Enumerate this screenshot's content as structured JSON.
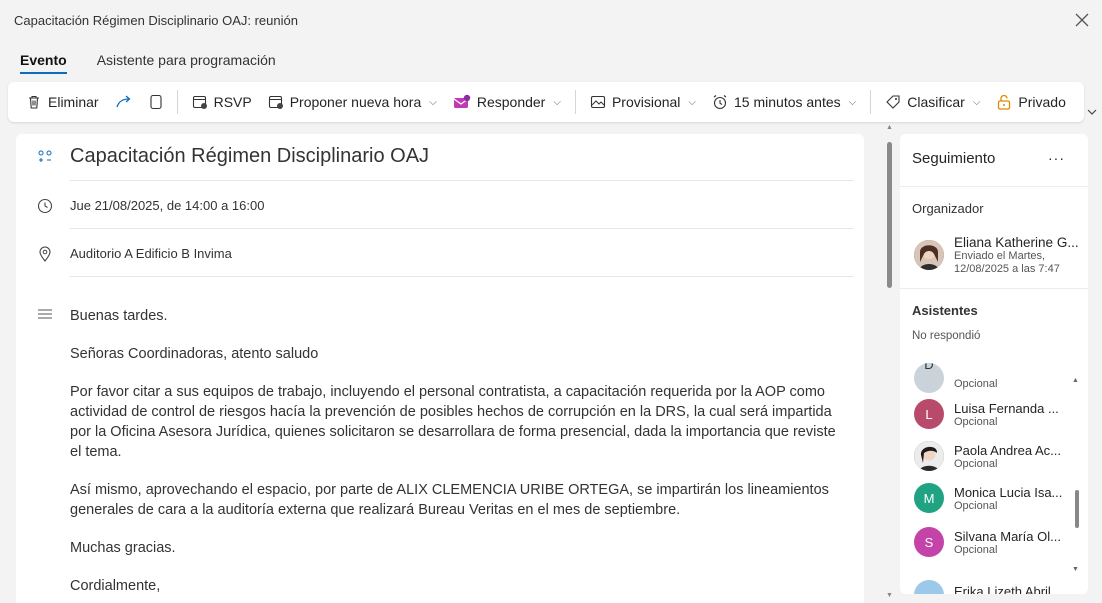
{
  "window": {
    "title": "Capacitación Régimen Disciplinario OAJ: reunión"
  },
  "tabs": [
    {
      "label": "Evento",
      "active": true
    },
    {
      "label": "Asistente para programación",
      "active": false
    }
  ],
  "ribbon": {
    "delete": "Eliminar",
    "rsvp": "RSVP",
    "propose": "Proponer nueva hora",
    "respond": "Responder",
    "status": "Provisional",
    "reminder": "15 minutos antes",
    "classify": "Clasificar",
    "private": "Privado"
  },
  "event": {
    "subject": "Capacitación Régimen Disciplinario OAJ",
    "datetime": "Jue 21/08/2025, de 14:00 a 16:00",
    "location": "Auditorio A Edificio B Invima",
    "body": [
      "Buenas tardes.",
      "Señoras Coordinadoras, atento saludo",
      "Por favor citar a sus equipos de trabajo, incluyendo el personal contratista, a capacitación requerida por la AOP como actividad de control de riesgos hacía la prevención de posibles hechos de corrupción en la DRS, la cual será impartida por la Oficina Asesora Jurídica, quienes solicitaron se desarrollara de forma presencial, dada la importancia que reviste el tema.",
      "Así mismo, aprovechando el espacio, por parte de ALIX CLEMENCIA URIBE ORTEGA, se impartirán los lineamientos generales de cara a la auditoría externa que realizará Bureau Veritas en el mes de septiembre.",
      "Muchas gracias.",
      "Cordialmente,"
    ]
  },
  "tracking": {
    "title": "Seguimiento",
    "organizer_label": "Organizador",
    "organizer": {
      "name": "Eliana Katherine G...",
      "sent_line1": "Enviado el Martes,",
      "sent_line2": "12/08/2025 a las 7:47"
    },
    "attendees_label": "Asistentes",
    "no_response_label": "No respondió",
    "attendees": [
      {
        "initial": "D",
        "name": "",
        "role": "Opcional",
        "color": "#c9d3d9"
      },
      {
        "initial": "L",
        "name": "Luisa Fernanda ...",
        "role": "Opcional",
        "color": "#b84a6b"
      },
      {
        "initial": "",
        "name": "Paola Andrea Ac...",
        "role": "Opcional",
        "color": "#3a3a3a"
      },
      {
        "initial": "M",
        "name": "Monica Lucia Isa...",
        "role": "Opcional",
        "color": "#20a383"
      },
      {
        "initial": "S",
        "name": "Silvana María Ol...",
        "role": "Opcional",
        "color": "#c443a9"
      },
      {
        "initial": "",
        "name": "Erika Lizeth Abril",
        "role": "",
        "color": "#9cc8ea"
      }
    ]
  },
  "colors": {
    "accent": "#0f6cbd",
    "respond_icon": "#c239b3",
    "private_icon": "#e08a00"
  }
}
